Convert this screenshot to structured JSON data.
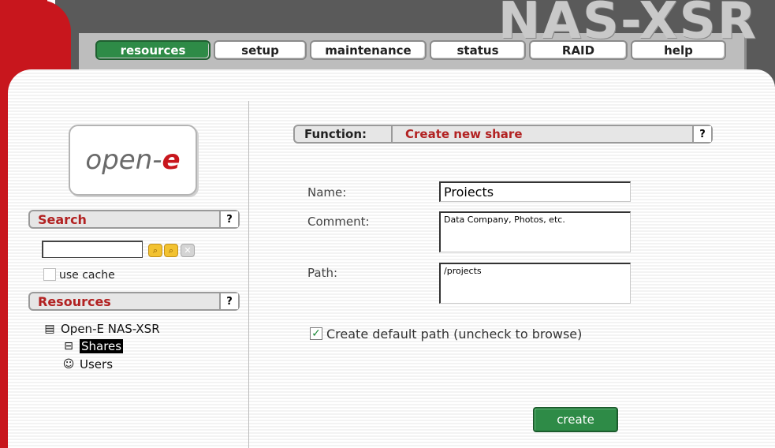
{
  "header": {
    "brand": "NAS-XSR",
    "tabs": [
      {
        "label": "resources",
        "active": true
      },
      {
        "label": "setup",
        "active": false
      },
      {
        "label": "maintenance",
        "active": false
      },
      {
        "label": "status",
        "active": false
      },
      {
        "label": "RAID",
        "active": false
      },
      {
        "label": "help",
        "active": false
      }
    ]
  },
  "sidebar": {
    "logo_text": "open-",
    "logo_accent": "e",
    "search": {
      "title": "Search",
      "help": "?",
      "input_value": "",
      "use_cache_label": "use cache",
      "use_cache_checked": false
    },
    "resources": {
      "title": "Resources",
      "help": "?",
      "tree": {
        "root": "Open-E NAS-XSR",
        "children": [
          {
            "label": "Shares",
            "selected": true,
            "icon": "shares-icon"
          },
          {
            "label": "Users",
            "selected": false,
            "icon": "users-icon"
          }
        ]
      }
    }
  },
  "main": {
    "function_label": "Function:",
    "function_value": "Create new share",
    "help": "?",
    "form": {
      "name_label": "Name:",
      "name_value": "Proiects",
      "comment_label": "Comment:",
      "comment_value": "Data Company, Photos, etc.",
      "path_label": "Path:",
      "path_value": "/projects",
      "default_path_label": "Create default path (uncheck to browse)",
      "default_path_checked": true
    },
    "create_label": "create"
  },
  "colors": {
    "accent_green": "#2e8b47",
    "brand_red": "#c8161d",
    "header_gray": "#5a5a5a",
    "label_red": "#b22222"
  }
}
